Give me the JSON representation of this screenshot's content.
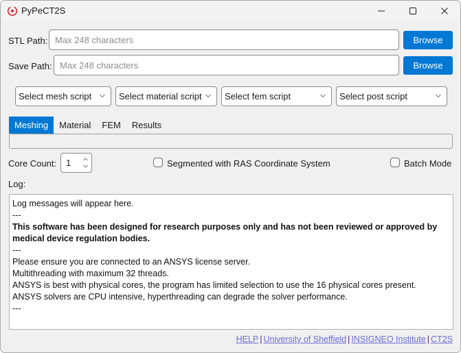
{
  "window": {
    "title": "PyPeCT2S",
    "accent_color": "#0078d4",
    "icon_color": "#d9232e"
  },
  "paths": {
    "stl_label": "STL Path:",
    "stl_placeholder": "Max 248 characters",
    "stl_value": "",
    "save_label": "Save Path:",
    "save_placeholder": "Max 248 characters",
    "save_value": "",
    "browse_label": "Browse"
  },
  "scripts": [
    {
      "label": "Select mesh script"
    },
    {
      "label": "Select material script"
    },
    {
      "label": "Select fem script"
    },
    {
      "label": "Select post script"
    }
  ],
  "tabs": [
    {
      "label": "Meshing",
      "active": true
    },
    {
      "label": "Material",
      "active": false
    },
    {
      "label": "FEM",
      "active": false
    },
    {
      "label": "Results",
      "active": false
    }
  ],
  "options": {
    "core_count_label": "Core Count:",
    "core_count_value": "1",
    "segmented_label": "Segmented with RAS Coordinate System",
    "segmented_checked": false,
    "batch_label": "Batch Mode",
    "batch_checked": false
  },
  "log": {
    "label": "Log:",
    "lines": [
      {
        "text": "Log messages will appear here.",
        "bold": false
      },
      {
        "text": "---",
        "bold": false
      },
      {
        "text": "This software has been designed for research purposes only and has not been reviewed or approved by medical device regulation bodies.",
        "bold": true
      },
      {
        "text": "---",
        "bold": false
      },
      {
        "text": "Please ensure you are connected to an ANSYS license server.",
        "bold": false
      },
      {
        "text": "Multithreading with maximum 32 threads.",
        "bold": false
      },
      {
        "text": "ANSYS is best with physical cores, the program has limited selection to use the 16 physical cores present.",
        "bold": false
      },
      {
        "text": "ANSYS solvers are CPU intensive, hyperthreading can degrade the solver performance.",
        "bold": false
      },
      {
        "text": "---",
        "bold": false
      }
    ]
  },
  "footer": {
    "links": [
      "HELP",
      "University of Sheffield",
      "INSIGNEO Institute",
      "CT2S"
    ],
    "separator": "|"
  }
}
